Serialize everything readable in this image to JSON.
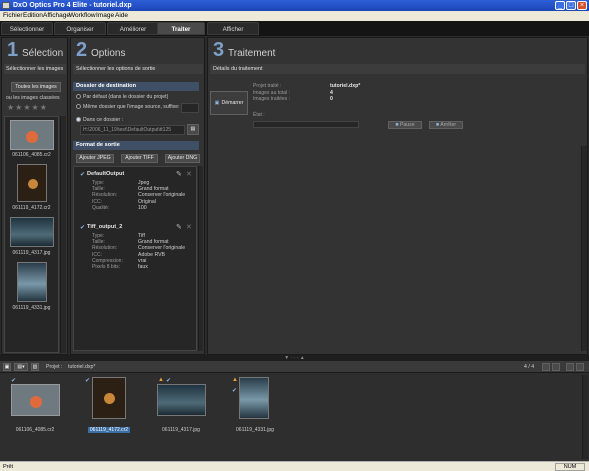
{
  "window": {
    "title": "DxO Optics Pro 4 Elite - tutoriel.dxp"
  },
  "menu": [
    "Fichier",
    "Edition",
    "Affichage",
    "Workflow",
    "Image",
    "Aide"
  ],
  "tabs": [
    "Sélectionner",
    "Organiser",
    "Améliorer",
    "Traiter",
    "Afficher"
  ],
  "active_tab": "Traiter",
  "panel1": {
    "number": "1",
    "title": "Sélection",
    "subtitle": "Sélectionner les images",
    "filter_button": "Toutes les images",
    "filter_sub": "ou les images classées",
    "stars": "★★★★★",
    "thumbs": [
      "061106_4085.cr2",
      "061119_4172.cr2",
      "061119_4317.jpg",
      "061119_4331.jpg"
    ]
  },
  "panel2": {
    "number": "2",
    "title": "Options",
    "subtitle": "Sélectionner les options de sortie",
    "dest": {
      "header": "Dossier de destination",
      "opt1": "Par défaut (dans le dossier du projet)",
      "opt2": "Même dossier que l'image source, suffixe:",
      "opt3": "Dans ce dossier :",
      "path": "H:\\2006_11_19\\test\\DefaultOutput\\tt125"
    },
    "format": {
      "header": "Format de sortie",
      "buttons": [
        "Ajouter JPEG",
        "Ajouter TIFF",
        "Ajouter DNG"
      ],
      "outputs": [
        {
          "name": "DefaultOutput",
          "rows": [
            [
              "Type:",
              "Jpeg"
            ],
            [
              "Taille:",
              "Grand format"
            ],
            [
              "Résolution:",
              "Conserver l'originale"
            ],
            [
              "ICC:",
              "Original"
            ],
            [
              "Qualité:",
              "100"
            ]
          ]
        },
        {
          "name": "Tiff_output_2",
          "rows": [
            [
              "Type:",
              "Tiff"
            ],
            [
              "Taille:",
              "Grand format"
            ],
            [
              "Résolution:",
              "Conserver l'originale"
            ],
            [
              "ICC:",
              "Adobe RVB"
            ],
            [
              "Compression:",
              "vrai"
            ],
            [
              "Pixels 8 bits:",
              "faux"
            ]
          ]
        }
      ]
    }
  },
  "panel3": {
    "number": "3",
    "title": "Traitement",
    "subtitle": "Détails du traitement",
    "start_button": "Démarrer",
    "details": [
      [
        "Projet traité :",
        "tutoriel.dxp*"
      ],
      [
        "Images au total :",
        "4"
      ],
      [
        "Images traitées :",
        "0"
      ]
    ],
    "state_label": "État :",
    "pause_button": "Pause",
    "stop_button": "Arrêter"
  },
  "project_bar": {
    "label": "Projet :",
    "name": "tutoriel.dxp*",
    "count": "4 / 4"
  },
  "filmstrip": [
    "061106_4085.cr2",
    "061119_4172.cr2",
    "061119_4317.jpg",
    "061119_4331.jpg"
  ],
  "filmstrip_selected": "061119_4172.cr2",
  "statusbar": {
    "left": "Prêt",
    "right": "NUM"
  },
  "colors": {
    "accent": "#7d9fc8",
    "titlebar": "#1b45b7",
    "selection": "#3a6ea5"
  }
}
